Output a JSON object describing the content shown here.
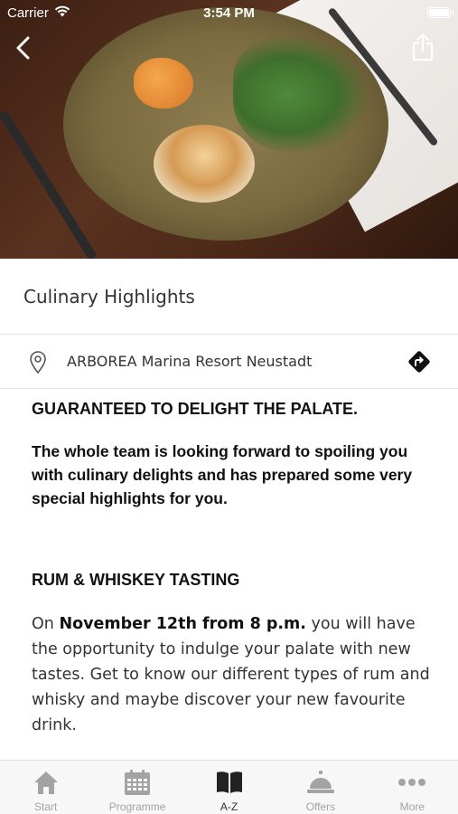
{
  "status_bar": {
    "carrier": "Carrier",
    "time": "3:54 PM"
  },
  "hero": {
    "image_alt": "Plated dish on wooden table"
  },
  "page": {
    "title": "Culinary Highlights",
    "location": "ARBOREA Marina Resort Neustadt"
  },
  "article": {
    "heading": "GUARANTEED TO DELIGHT THE PALATE.",
    "intro": "The whole team is looking forward to spoiling you with culinary delights and has prepared some very special highlights for you.",
    "event_heading": "RUM & WHISKEY TASTING",
    "event_lead": "On ",
    "event_date": "November 12th from 8 p.m.",
    "event_body": " you will have the opportunity to indulge your palate with new tastes. Get to know our different types of rum and whisky and maybe discover your new favourite drink."
  },
  "tabs": [
    {
      "label": "Start",
      "icon": "home-icon",
      "active": false
    },
    {
      "label": "Programme",
      "icon": "calendar-icon",
      "active": false
    },
    {
      "label": "A-Z",
      "icon": "book-icon",
      "active": true
    },
    {
      "label": "Offers",
      "icon": "service-bell-icon",
      "active": false
    },
    {
      "label": "More",
      "icon": "more-dots-icon",
      "active": false
    }
  ],
  "colors": {
    "tab_inactive": "#a3a3a3",
    "tab_active": "#222222",
    "divider": "#e3e3e3"
  }
}
